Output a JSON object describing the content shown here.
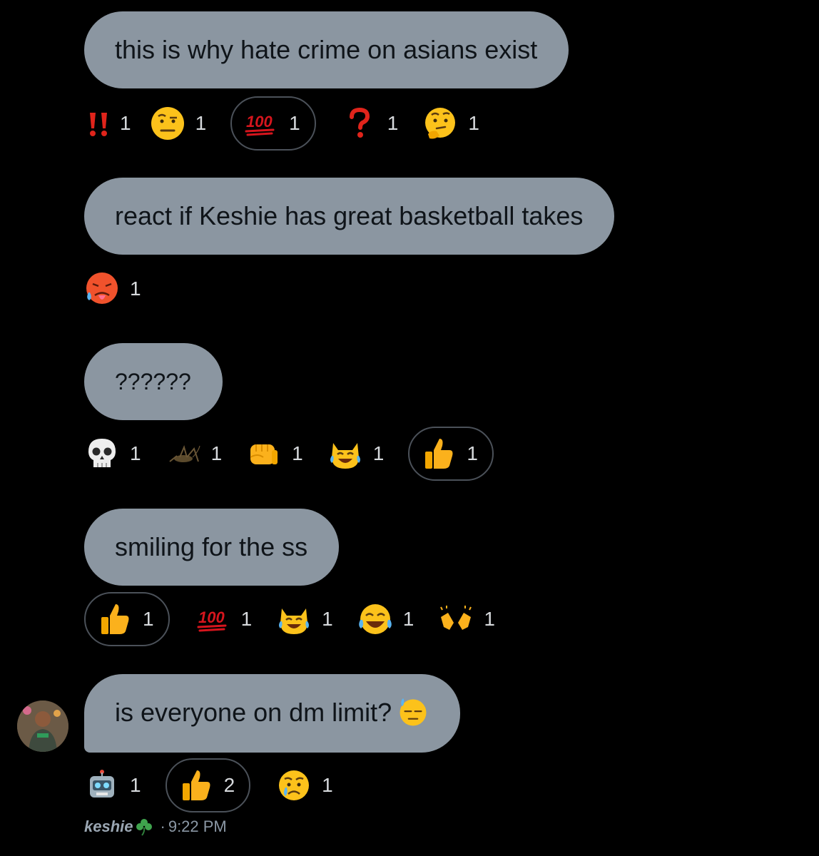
{
  "messages": [
    {
      "text": "this is why hate crime on asians exist",
      "reactions": [
        {
          "icon": "double-exclamation-icon",
          "count": "1",
          "active": false
        },
        {
          "icon": "raised-eyebrow-face-icon",
          "count": "1",
          "active": false
        },
        {
          "icon": "hundred-points-icon",
          "count": "1",
          "active": true
        },
        {
          "icon": "question-mark-icon",
          "count": "1",
          "active": false
        },
        {
          "icon": "thinking-face-icon",
          "count": "1",
          "active": false
        }
      ]
    },
    {
      "text": "react if Keshie has great basketball takes",
      "reactions": [
        {
          "icon": "hot-face-icon",
          "count": "1",
          "active": false
        }
      ]
    },
    {
      "text": "??????",
      "reactions": [
        {
          "icon": "skull-icon",
          "count": "1",
          "active": false
        },
        {
          "icon": "cricket-icon",
          "count": "1",
          "active": false
        },
        {
          "icon": "fist-icon",
          "count": "1",
          "active": false
        },
        {
          "icon": "cat-tears-of-joy-icon",
          "count": "1",
          "active": false
        },
        {
          "icon": "thumbs-up-icon",
          "count": "1",
          "active": true
        }
      ]
    },
    {
      "text": "smiling for the ss",
      "reactions": [
        {
          "icon": "thumbs-up-icon",
          "count": "1",
          "active": true
        },
        {
          "icon": "hundred-points-icon",
          "count": "1",
          "active": false
        },
        {
          "icon": "cat-tears-of-joy-icon",
          "count": "1",
          "active": false
        },
        {
          "icon": "tears-of-joy-icon",
          "count": "1",
          "active": false
        },
        {
          "icon": "raising-hands-icon",
          "count": "1",
          "active": false
        }
      ]
    },
    {
      "text": "is everyone on dm limit?",
      "trailing_emoji": "downcast-sweat-face-icon",
      "reactions": [
        {
          "icon": "robot-icon",
          "count": "1",
          "active": false
        },
        {
          "icon": "thumbs-up-icon",
          "count": "2",
          "active": true
        },
        {
          "icon": "crying-face-icon",
          "count": "1",
          "active": false
        }
      ]
    }
  ],
  "footer": {
    "sender": "keshie",
    "sender_emoji": "shamrock-icon",
    "separator": "·",
    "time": "9:22 PM"
  },
  "colors": {
    "background": "#000000",
    "bubble": "#8b96a1",
    "bubble_text": "#0f1419",
    "count_text": "#d6d9dc",
    "active_border": "#4b5159"
  }
}
